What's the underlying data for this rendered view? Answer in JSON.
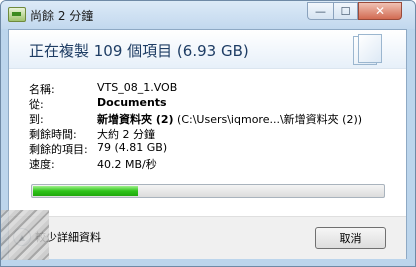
{
  "window": {
    "title": "尚餘 2 分鐘",
    "controls": {
      "minimize": "—",
      "maximize": "☐",
      "close": "✕"
    }
  },
  "header": {
    "text": "正在複製 109 個項目 (6.93 GB)"
  },
  "details": [
    {
      "label": "名稱:",
      "value": "VTS_08_1.VOB",
      "bold": false
    },
    {
      "label": "從:",
      "value": "Documents",
      "bold": true
    },
    {
      "label": "到:",
      "value": "新增資料夾 (2)",
      "extra": " (C:\\Users\\iqmore...\\新增資料夾 (2))",
      "bold": true
    },
    {
      "label": "剩餘時間:",
      "value": "大約 2 分鐘",
      "bold": false
    },
    {
      "label": "剩餘的項目:",
      "value": "79 (4.81 GB)",
      "bold": false
    },
    {
      "label": "速度:",
      "value": "40.2 MB/秒",
      "bold": false
    }
  ],
  "progress": {
    "fraction": 0.3,
    "color": "#2fc41a"
  },
  "footer": {
    "toggle_label": "較少詳細資料",
    "cancel_label": "取消"
  },
  "icons": {
    "title": "copy-progress-icon",
    "header": "documents-icon",
    "toggle": "chevron-up-icon"
  }
}
